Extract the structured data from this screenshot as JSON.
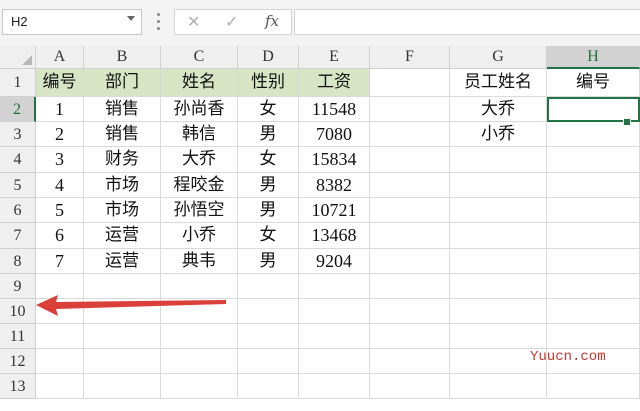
{
  "formula_bar": {
    "name_box": "H2",
    "cancel_icon": "✕",
    "enter_icon": "✓",
    "function_icon": "fx",
    "formula": ""
  },
  "columns": [
    "A",
    "B",
    "C",
    "D",
    "E",
    "F",
    "G",
    "H"
  ],
  "selected_column": "H",
  "rows": [
    "1",
    "2",
    "3",
    "4",
    "5",
    "6",
    "7",
    "8",
    "9",
    "10",
    "11",
    "12",
    "13"
  ],
  "selected_row": "2",
  "table": {
    "headers": [
      "编号",
      "部门",
      "姓名",
      "性别",
      "工资"
    ],
    "rows": [
      [
        "1",
        "销售",
        "孙尚香",
        "女",
        "11548"
      ],
      [
        "2",
        "销售",
        "韩信",
        "男",
        "7080"
      ],
      [
        "3",
        "财务",
        "大乔",
        "女",
        "15834"
      ],
      [
        "4",
        "市场",
        "程咬金",
        "男",
        "8382"
      ],
      [
        "5",
        "市场",
        "孙悟空",
        "男",
        "10721"
      ],
      [
        "6",
        "运营",
        "小乔",
        "女",
        "13468"
      ],
      [
        "7",
        "运营",
        "典韦",
        "男",
        "9204"
      ]
    ]
  },
  "lookup": {
    "g_header": "员工姓名",
    "h_header": "编号",
    "names": [
      "大乔",
      "小乔"
    ],
    "results": [
      "",
      ""
    ]
  },
  "colors": {
    "header_fill": "#d8e5c5",
    "selection": "#217346",
    "arrow": "#d9403a"
  },
  "watermark": "Yuucn.com"
}
